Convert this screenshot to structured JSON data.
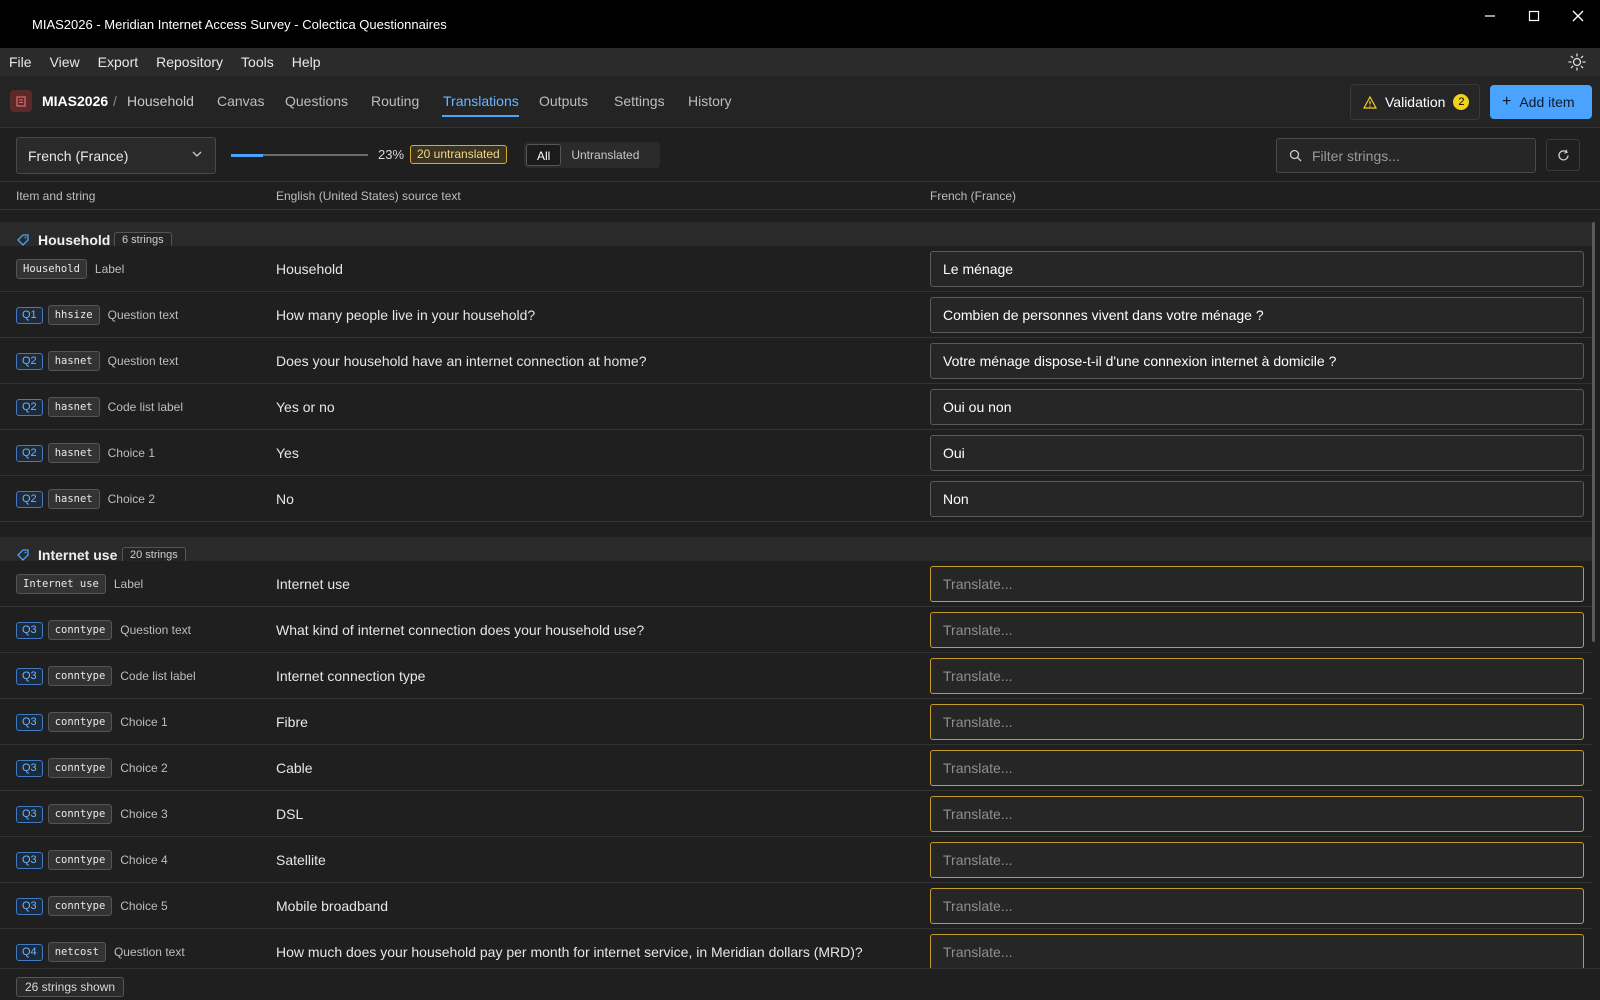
{
  "window": {
    "title": "MIAS2026 - Meridian Internet Access Survey - Colectica Questionnaires"
  },
  "menu": [
    "File",
    "View",
    "Export",
    "Repository",
    "Tools",
    "Help"
  ],
  "nav": {
    "root": "MIAS2026",
    "separator": "/",
    "current": "Household",
    "tabs": [
      "Canvas",
      "Questions",
      "Routing",
      "Translations",
      "Outputs",
      "Settings",
      "History"
    ],
    "active_tab": "Translations",
    "validation_label": "Validation",
    "validation_count": "2",
    "add_label": "Add item"
  },
  "toolbar": {
    "language": "French (France)",
    "progress_pct": "23%",
    "progress_value": 0.23,
    "untranslated_badge": "20 untranslated",
    "filter_all": "All",
    "filter_untranslated": "Untranslated",
    "search_placeholder": "Filter strings..."
  },
  "columns": {
    "item": "Item and string",
    "source": "English (United States) source text",
    "target": "French (France)"
  },
  "groups": [
    {
      "name": "Household",
      "count": "6 strings",
      "rows": [
        {
          "q": "",
          "name": "Household",
          "kind": "Label",
          "source": "Household",
          "translation": "Le ménage"
        },
        {
          "q": "Q1",
          "name": "hhsize",
          "kind": "Question text",
          "source": "How many people live in your household?",
          "translation": "Combien de personnes vivent dans votre ménage ?"
        },
        {
          "q": "Q2",
          "name": "hasnet",
          "kind": "Question text",
          "source": "Does your household have an internet connection at home?",
          "translation": "Votre ménage dispose-t-il d'une connexion internet à domicile ?"
        },
        {
          "q": "Q2",
          "name": "hasnet",
          "kind": "Code list label",
          "source": "Yes or no",
          "translation": "Oui ou non"
        },
        {
          "q": "Q2",
          "name": "hasnet",
          "kind": "Choice 1",
          "source": "Yes",
          "translation": "Oui"
        },
        {
          "q": "Q2",
          "name": "hasnet",
          "kind": "Choice 2",
          "source": "No",
          "translation": "Non"
        }
      ]
    },
    {
      "name": "Internet use",
      "count": "20 strings",
      "rows": [
        {
          "q": "",
          "name": "Internet use",
          "kind": "Label",
          "source": "Internet use",
          "translation": ""
        },
        {
          "q": "Q3",
          "name": "conntype",
          "kind": "Question text",
          "source": "What kind of internet connection does your household use?",
          "translation": ""
        },
        {
          "q": "Q3",
          "name": "conntype",
          "kind": "Code list label",
          "source": "Internet connection type",
          "translation": ""
        },
        {
          "q": "Q3",
          "name": "conntype",
          "kind": "Choice 1",
          "source": "Fibre",
          "translation": ""
        },
        {
          "q": "Q3",
          "name": "conntype",
          "kind": "Choice 2",
          "source": "Cable",
          "translation": ""
        },
        {
          "q": "Q3",
          "name": "conntype",
          "kind": "Choice 3",
          "source": "DSL",
          "translation": ""
        },
        {
          "q": "Q3",
          "name": "conntype",
          "kind": "Choice 4",
          "source": "Satellite",
          "translation": ""
        },
        {
          "q": "Q3",
          "name": "conntype",
          "kind": "Choice 5",
          "source": "Mobile broadband",
          "translation": ""
        },
        {
          "q": "Q4",
          "name": "netcost",
          "kind": "Question text",
          "source": "How much does your household pay per month for internet service, in Meridian dollars (MRD)?",
          "translation": ""
        }
      ]
    }
  ],
  "translate_placeholder": "Translate...",
  "status": {
    "shown": "26 strings shown"
  },
  "colors": {
    "accent": "#4aa3ff",
    "warning": "#d6a92b",
    "badge": "#f2d11c"
  }
}
